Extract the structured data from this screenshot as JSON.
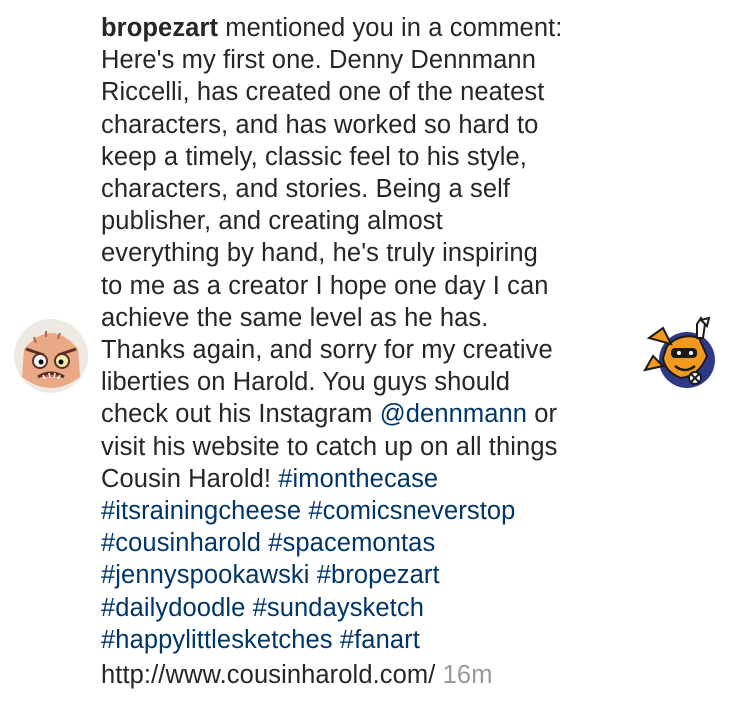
{
  "notification": {
    "username": "bropezart",
    "action_text": " mentioned you in a comment:",
    "lines": [
      "Here's my first one. Denny Dennmann",
      "Riccelli, has created one of the neatest",
      "characters, and has worked so hard to",
      "keep a timely, classic feel to his style,",
      "characters, and stories. Being a self",
      "publisher, and creating almost",
      "everything by hand, he's truly inspiring",
      "to me as a creator I hope one day I can",
      "achieve the same level as he has.",
      "Thanks again, and sorry for my creative",
      "liberties on Harold. You guys should"
    ],
    "mention_prefix": "check out his Instagram ",
    "mention": "@dennmann",
    "mention_suffix": " or",
    "line_visit": "visit his website to catch up on all things",
    "line_cousin_prefix": "Cousin Harold! ",
    "hashtags": {
      "imonthecase": "#imonthecase",
      "itsrainingcheese": "#itsrainingcheese",
      "comicsneverstop": "#comicsneverstop",
      "cousinharold": "#cousinharold",
      "spacemontas": "#spacemontas",
      "jennyspookawski": "#jennyspookawski",
      "bropezart": "#bropezart",
      "dailydoodle": "#dailydoodle",
      "sundaysketch": "#sundaysketch",
      "happylittlesketches": "#happylittlesketches",
      "fanart": "#fanart"
    },
    "url": "http://www.cousinharold.com/",
    "timestamp": "16m",
    "avatar_icon": "cartoon-face-avatar-icon",
    "thumbnail_icon": "orange-fox-character-thumbnail",
    "colors": {
      "text": "#262626",
      "link": "#003569",
      "timestamp": "#999999",
      "background": "#ffffff"
    }
  }
}
